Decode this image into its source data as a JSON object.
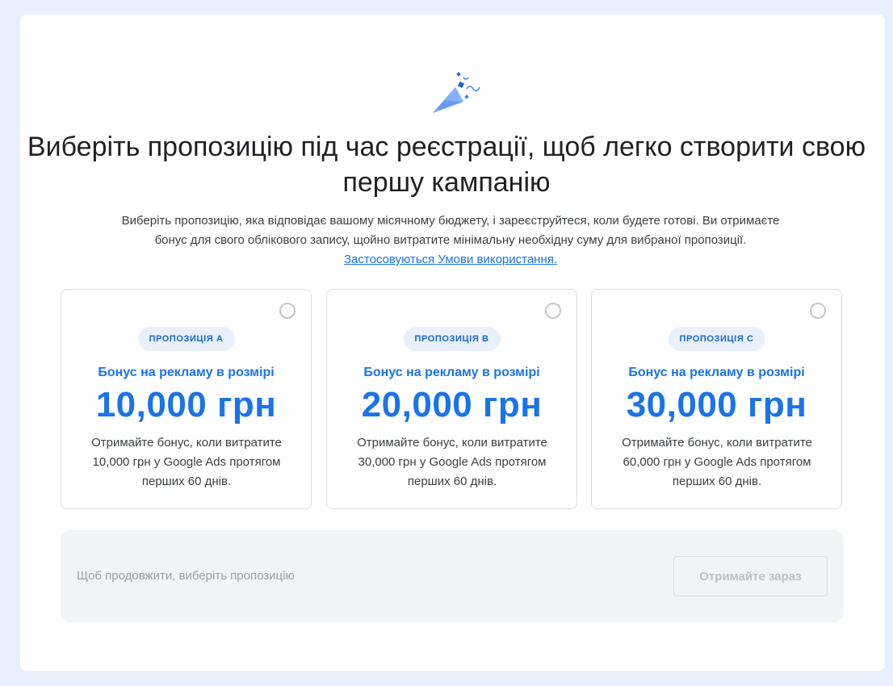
{
  "header": {
    "icon": "party-popper-icon",
    "title": "Виберіть пропозицію під час реєстрації, щоб легко створити свою першу кампанію",
    "subtitle_text": "Виберіть пропозицію, яка відповідає вашому місячному бюджету, і зареєструйтеся, коли будете готові. Ви отримаєте бонус для свого облікового запису, щойно витратите мінімальну необхідну суму для вибраної пропозиції.",
    "terms_link": "Застосовуються Умови використання."
  },
  "offers": [
    {
      "chip": "ПРОПОЗИЦІЯ A",
      "bonus_label": "Бонус на рекламу в розмірі",
      "amount": "10,000 грн",
      "description": "Отримайте бонус, коли витратите 10,000 грн у Google Ads протягом перших 60 днів.",
      "selected": false
    },
    {
      "chip": "ПРОПОЗИЦІЯ B",
      "bonus_label": "Бонус на рекламу в розмірі",
      "amount": "20,000 грн",
      "description": "Отримайте бонус, коли витратите 30,000 грн у Google Ads протягом перших 60 днів.",
      "selected": false
    },
    {
      "chip": "ПРОПОЗИЦІЯ C",
      "bonus_label": "Бонус на рекламу в розмірі",
      "amount": "30,000 грн",
      "description": "Отримайте бонус, коли витратите 60,000 грн у Google Ads протягом перших 60 днів.",
      "selected": false
    }
  ],
  "footer": {
    "hint": "Щоб продовжити, виберіть пропозицію",
    "cta_label": "Отримайте зараз",
    "cta_enabled": false
  },
  "colors": {
    "page_background": "#e8f0fe",
    "accent": "#1a73e8",
    "chip_background": "#e8f0fe",
    "footer_background": "#f1f3f4"
  }
}
